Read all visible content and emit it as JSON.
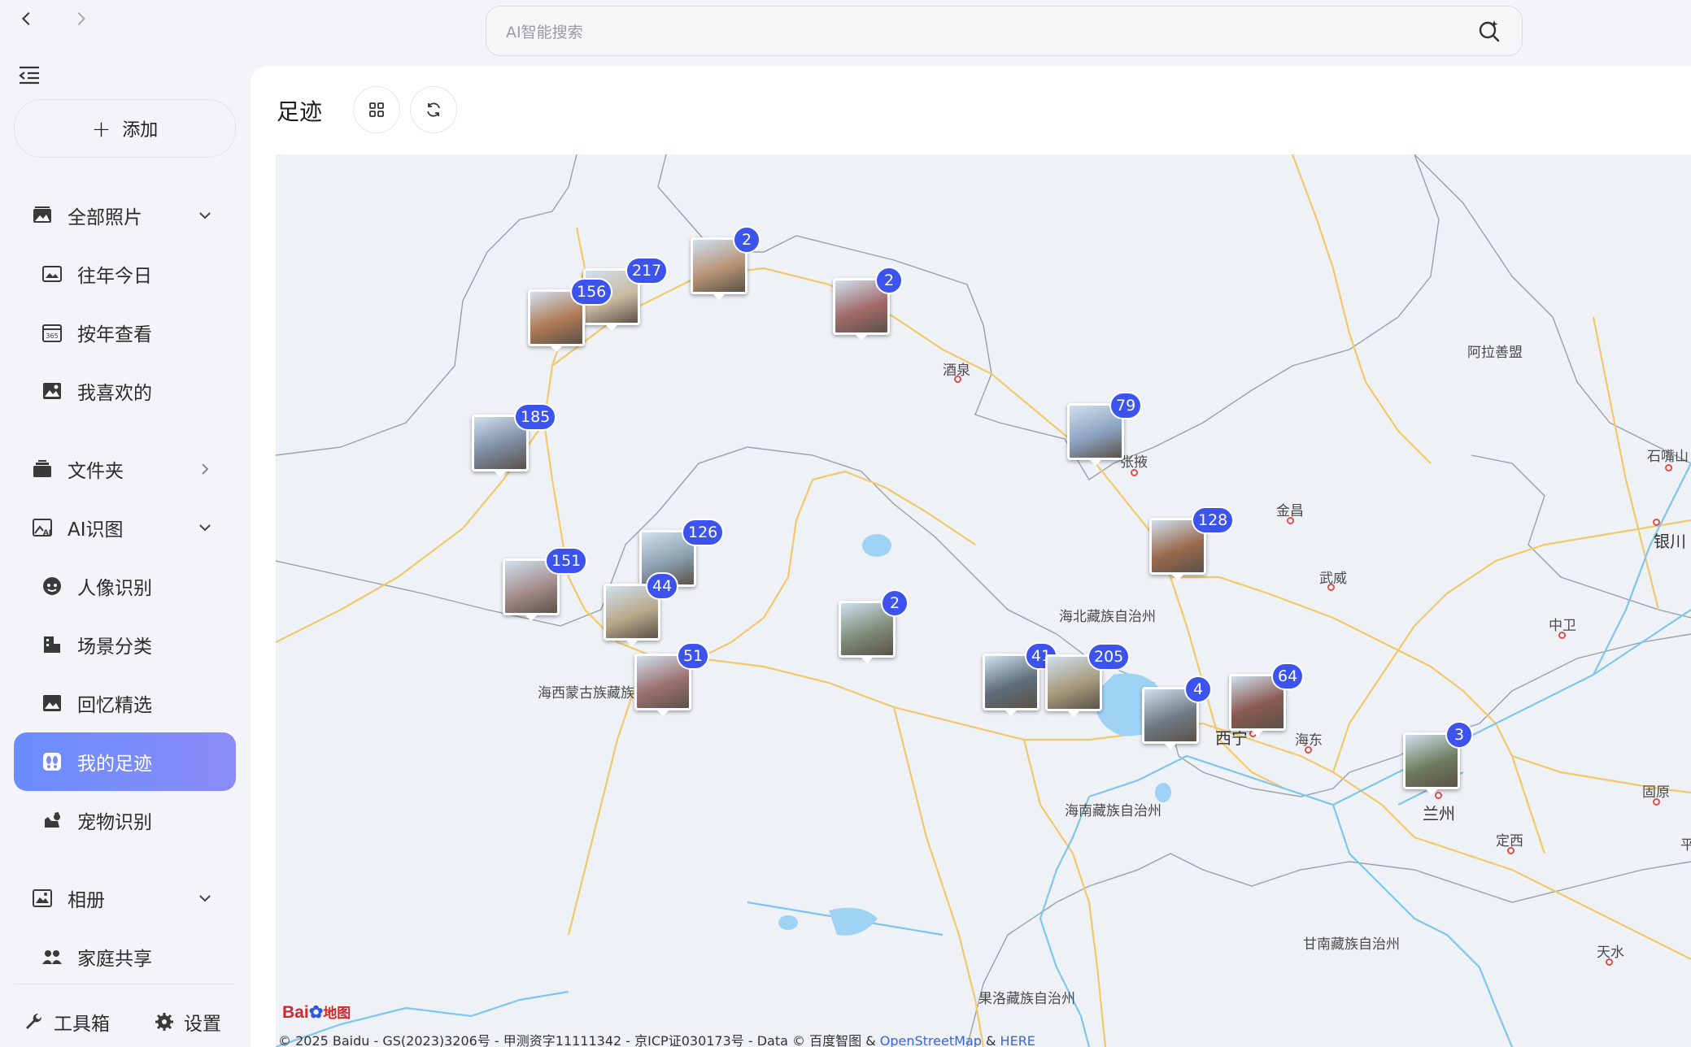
{
  "search": {
    "placeholder": "AI智能搜索"
  },
  "sidebar": {
    "add_label": "添加",
    "items": [
      {
        "label": "全部照片",
        "icon": "photos-icon"
      },
      {
        "label": "往年今日",
        "icon": "image-frame-icon"
      },
      {
        "label": "按年查看",
        "icon": "calendar-365-icon"
      },
      {
        "label": "我喜欢的",
        "icon": "favorite-image-icon"
      },
      {
        "label": "文件夹",
        "icon": "folder-stack-icon"
      },
      {
        "label": "AI识图",
        "icon": "ai-image-icon"
      },
      {
        "label": "人像识别",
        "icon": "face-icon"
      },
      {
        "label": "场景分类",
        "icon": "scene-icon"
      },
      {
        "label": "回忆精选",
        "icon": "memories-icon"
      },
      {
        "label": "我的足迹",
        "icon": "footprint-icon"
      },
      {
        "label": "宠物识别",
        "icon": "pet-icon"
      },
      {
        "label": "相册",
        "icon": "album-icon"
      },
      {
        "label": "家庭共享",
        "icon": "family-icon"
      }
    ],
    "active_item": "我的足迹",
    "toolbox_label": "工具箱",
    "settings_label": "设置"
  },
  "page": {
    "title": "足迹"
  },
  "map": {
    "places": [
      "酒泉",
      "张掖",
      "金昌",
      "武威",
      "阿拉善盟",
      "石嘴山",
      "银川",
      "中卫",
      "海北藏族自治州",
      "海西蒙古族藏族",
      "西宁",
      "海东",
      "兰州",
      "海南藏族自治州",
      "固原",
      "定西",
      "甘南藏族自治州",
      "天水",
      "果洛藏族自治州",
      "平"
    ],
    "markers": [
      {
        "count": "2",
        "photo_color": "#b89476"
      },
      {
        "count": "217",
        "photo_color": "#c9b9a0"
      },
      {
        "count": "156",
        "photo_color": "#b07a55"
      },
      {
        "count": "2",
        "photo_color": "#a26a6a"
      },
      {
        "count": "185",
        "photo_color": "#7c8aa0"
      },
      {
        "count": "79",
        "photo_color": "#8aa2bf"
      },
      {
        "count": "128",
        "photo_color": "#9b6a4e"
      },
      {
        "count": "126",
        "photo_color": "#8aa0b0"
      },
      {
        "count": "151",
        "photo_color": "#a48c8c"
      },
      {
        "count": "44",
        "photo_color": "#b9a88a"
      },
      {
        "count": "2",
        "photo_color": "#7f8b7a"
      },
      {
        "count": "51",
        "photo_color": "#9c7070"
      },
      {
        "count": "41",
        "photo_color": "#5f6d7a"
      },
      {
        "count": "205",
        "photo_color": "#a79a7c"
      },
      {
        "count": "4",
        "photo_color": "#707a85"
      },
      {
        "count": "64",
        "photo_color": "#8a5a52"
      },
      {
        "count": "3",
        "photo_color": "#6f7d5e"
      }
    ],
    "logo_text": "Bai",
    "logo_text2": "地图",
    "copyright": "© 2025 Baidu - GS(2023)3206号 - 甲测资字11111342 - 京ICP证030173号 - Data © 百度智图 & ",
    "osm_link": "OpenStreetMap",
    "amp": " & ",
    "here_link": "HERE"
  }
}
